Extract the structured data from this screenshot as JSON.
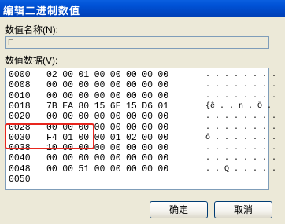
{
  "window": {
    "title": "编辑二进制数值"
  },
  "value_name": {
    "label": "数值名称(N):",
    "value": "F"
  },
  "value_data": {
    "label": "数值数据(V):",
    "rows": [
      {
        "offset": "0000",
        "hex": [
          "02",
          "00",
          "01",
          "00",
          "00",
          "00",
          "00",
          "00"
        ],
        "ascii": ". . . . . . . ."
      },
      {
        "offset": "0008",
        "hex": [
          "00",
          "00",
          "00",
          "00",
          "00",
          "00",
          "00",
          "00"
        ],
        "ascii": ". . . . . . . ."
      },
      {
        "offset": "0010",
        "hex": [
          "00",
          "00",
          "00",
          "00",
          "00",
          "00",
          "00",
          "00"
        ],
        "ascii": ". . . . . . . ."
      },
      {
        "offset": "0018",
        "hex": [
          "7B",
          "EA",
          "80",
          "15",
          "6E",
          "15",
          "D6",
          "01"
        ],
        "ascii": "{ê . . n . Ö ."
      },
      {
        "offset": "0020",
        "hex": [
          "00",
          "00",
          "00",
          "00",
          "00",
          "00",
          "00",
          "00"
        ],
        "ascii": ". . . . . . . ."
      },
      {
        "offset": "0028",
        "hex": [
          "00",
          "00",
          "00",
          "00",
          "00",
          "00",
          "00",
          "00"
        ],
        "ascii": ". . . . . . . ."
      },
      {
        "offset": "0030",
        "hex": [
          "F4",
          "01",
          "00",
          "00",
          "01",
          "02",
          "00",
          "00"
        ],
        "ascii": "ô . . . . . . ."
      },
      {
        "offset": "0038",
        "hex": [
          "10",
          "00",
          "00",
          "00",
          "00",
          "00",
          "00",
          "00"
        ],
        "ascii": ". . . . . . . ."
      },
      {
        "offset": "0040",
        "hex": [
          "00",
          "00",
          "00",
          "00",
          "00",
          "00",
          "00",
          "00"
        ],
        "ascii": ". . . . . . . ."
      },
      {
        "offset": "0048",
        "hex": [
          "00",
          "00",
          "51",
          "00",
          "00",
          "00",
          "00",
          "00"
        ],
        "ascii": ". . Q . . . . ."
      },
      {
        "offset": "0050",
        "hex": [],
        "ascii": ""
      }
    ]
  },
  "buttons": {
    "ok": "确定",
    "cancel": "取消"
  },
  "colors": {
    "highlight": "#e8261e",
    "titlebar": "#0052d6"
  }
}
